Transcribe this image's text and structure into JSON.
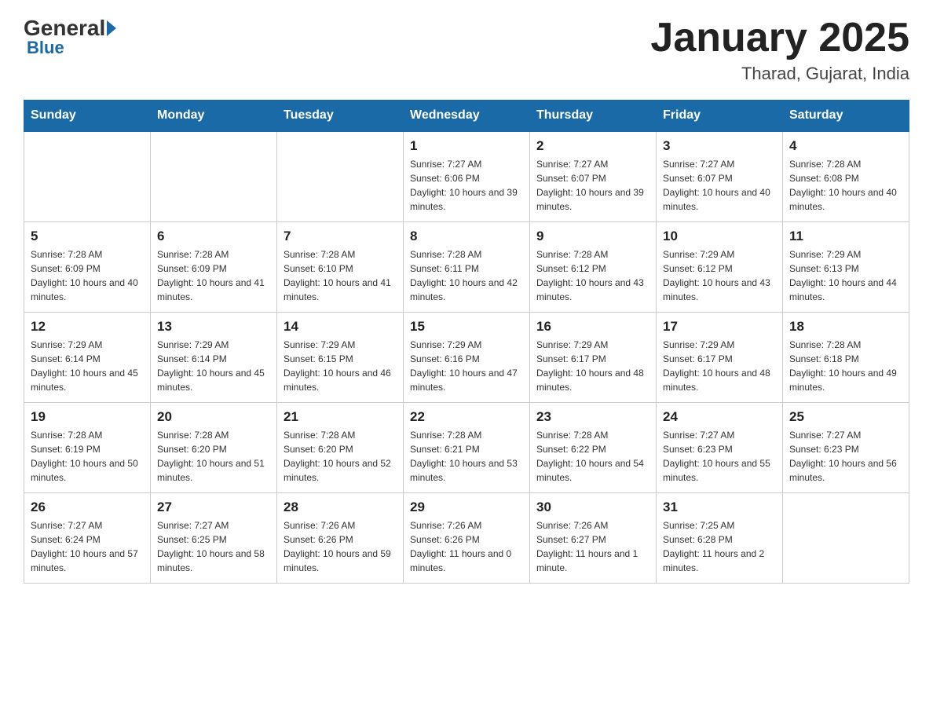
{
  "header": {
    "logo_general": "General",
    "logo_blue": "Blue",
    "month_title": "January 2025",
    "location": "Tharad, Gujarat, India"
  },
  "days_of_week": [
    "Sunday",
    "Monday",
    "Tuesday",
    "Wednesday",
    "Thursday",
    "Friday",
    "Saturday"
  ],
  "weeks": [
    [
      {
        "day": "",
        "sunrise": "",
        "sunset": "",
        "daylight": ""
      },
      {
        "day": "",
        "sunrise": "",
        "sunset": "",
        "daylight": ""
      },
      {
        "day": "",
        "sunrise": "",
        "sunset": "",
        "daylight": ""
      },
      {
        "day": "1",
        "sunrise": "Sunrise: 7:27 AM",
        "sunset": "Sunset: 6:06 PM",
        "daylight": "Daylight: 10 hours and 39 minutes."
      },
      {
        "day": "2",
        "sunrise": "Sunrise: 7:27 AM",
        "sunset": "Sunset: 6:07 PM",
        "daylight": "Daylight: 10 hours and 39 minutes."
      },
      {
        "day": "3",
        "sunrise": "Sunrise: 7:27 AM",
        "sunset": "Sunset: 6:07 PM",
        "daylight": "Daylight: 10 hours and 40 minutes."
      },
      {
        "day": "4",
        "sunrise": "Sunrise: 7:28 AM",
        "sunset": "Sunset: 6:08 PM",
        "daylight": "Daylight: 10 hours and 40 minutes."
      }
    ],
    [
      {
        "day": "5",
        "sunrise": "Sunrise: 7:28 AM",
        "sunset": "Sunset: 6:09 PM",
        "daylight": "Daylight: 10 hours and 40 minutes."
      },
      {
        "day": "6",
        "sunrise": "Sunrise: 7:28 AM",
        "sunset": "Sunset: 6:09 PM",
        "daylight": "Daylight: 10 hours and 41 minutes."
      },
      {
        "day": "7",
        "sunrise": "Sunrise: 7:28 AM",
        "sunset": "Sunset: 6:10 PM",
        "daylight": "Daylight: 10 hours and 41 minutes."
      },
      {
        "day": "8",
        "sunrise": "Sunrise: 7:28 AM",
        "sunset": "Sunset: 6:11 PM",
        "daylight": "Daylight: 10 hours and 42 minutes."
      },
      {
        "day": "9",
        "sunrise": "Sunrise: 7:28 AM",
        "sunset": "Sunset: 6:12 PM",
        "daylight": "Daylight: 10 hours and 43 minutes."
      },
      {
        "day": "10",
        "sunrise": "Sunrise: 7:29 AM",
        "sunset": "Sunset: 6:12 PM",
        "daylight": "Daylight: 10 hours and 43 minutes."
      },
      {
        "day": "11",
        "sunrise": "Sunrise: 7:29 AM",
        "sunset": "Sunset: 6:13 PM",
        "daylight": "Daylight: 10 hours and 44 minutes."
      }
    ],
    [
      {
        "day": "12",
        "sunrise": "Sunrise: 7:29 AM",
        "sunset": "Sunset: 6:14 PM",
        "daylight": "Daylight: 10 hours and 45 minutes."
      },
      {
        "day": "13",
        "sunrise": "Sunrise: 7:29 AM",
        "sunset": "Sunset: 6:14 PM",
        "daylight": "Daylight: 10 hours and 45 minutes."
      },
      {
        "day": "14",
        "sunrise": "Sunrise: 7:29 AM",
        "sunset": "Sunset: 6:15 PM",
        "daylight": "Daylight: 10 hours and 46 minutes."
      },
      {
        "day": "15",
        "sunrise": "Sunrise: 7:29 AM",
        "sunset": "Sunset: 6:16 PM",
        "daylight": "Daylight: 10 hours and 47 minutes."
      },
      {
        "day": "16",
        "sunrise": "Sunrise: 7:29 AM",
        "sunset": "Sunset: 6:17 PM",
        "daylight": "Daylight: 10 hours and 48 minutes."
      },
      {
        "day": "17",
        "sunrise": "Sunrise: 7:29 AM",
        "sunset": "Sunset: 6:17 PM",
        "daylight": "Daylight: 10 hours and 48 minutes."
      },
      {
        "day": "18",
        "sunrise": "Sunrise: 7:28 AM",
        "sunset": "Sunset: 6:18 PM",
        "daylight": "Daylight: 10 hours and 49 minutes."
      }
    ],
    [
      {
        "day": "19",
        "sunrise": "Sunrise: 7:28 AM",
        "sunset": "Sunset: 6:19 PM",
        "daylight": "Daylight: 10 hours and 50 minutes."
      },
      {
        "day": "20",
        "sunrise": "Sunrise: 7:28 AM",
        "sunset": "Sunset: 6:20 PM",
        "daylight": "Daylight: 10 hours and 51 minutes."
      },
      {
        "day": "21",
        "sunrise": "Sunrise: 7:28 AM",
        "sunset": "Sunset: 6:20 PM",
        "daylight": "Daylight: 10 hours and 52 minutes."
      },
      {
        "day": "22",
        "sunrise": "Sunrise: 7:28 AM",
        "sunset": "Sunset: 6:21 PM",
        "daylight": "Daylight: 10 hours and 53 minutes."
      },
      {
        "day": "23",
        "sunrise": "Sunrise: 7:28 AM",
        "sunset": "Sunset: 6:22 PM",
        "daylight": "Daylight: 10 hours and 54 minutes."
      },
      {
        "day": "24",
        "sunrise": "Sunrise: 7:27 AM",
        "sunset": "Sunset: 6:23 PM",
        "daylight": "Daylight: 10 hours and 55 minutes."
      },
      {
        "day": "25",
        "sunrise": "Sunrise: 7:27 AM",
        "sunset": "Sunset: 6:23 PM",
        "daylight": "Daylight: 10 hours and 56 minutes."
      }
    ],
    [
      {
        "day": "26",
        "sunrise": "Sunrise: 7:27 AM",
        "sunset": "Sunset: 6:24 PM",
        "daylight": "Daylight: 10 hours and 57 minutes."
      },
      {
        "day": "27",
        "sunrise": "Sunrise: 7:27 AM",
        "sunset": "Sunset: 6:25 PM",
        "daylight": "Daylight: 10 hours and 58 minutes."
      },
      {
        "day": "28",
        "sunrise": "Sunrise: 7:26 AM",
        "sunset": "Sunset: 6:26 PM",
        "daylight": "Daylight: 10 hours and 59 minutes."
      },
      {
        "day": "29",
        "sunrise": "Sunrise: 7:26 AM",
        "sunset": "Sunset: 6:26 PM",
        "daylight": "Daylight: 11 hours and 0 minutes."
      },
      {
        "day": "30",
        "sunrise": "Sunrise: 7:26 AM",
        "sunset": "Sunset: 6:27 PM",
        "daylight": "Daylight: 11 hours and 1 minute."
      },
      {
        "day": "31",
        "sunrise": "Sunrise: 7:25 AM",
        "sunset": "Sunset: 6:28 PM",
        "daylight": "Daylight: 11 hours and 2 minutes."
      },
      {
        "day": "",
        "sunrise": "",
        "sunset": "",
        "daylight": ""
      }
    ]
  ]
}
